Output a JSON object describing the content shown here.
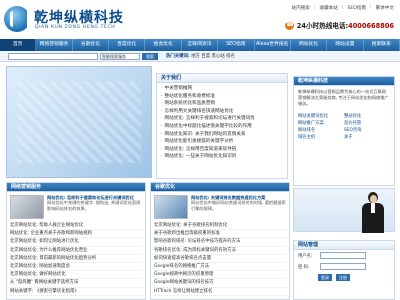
{
  "header": {
    "logo_cn": "乾坤纵横科技",
    "logo_en": "QIAN KUN ZONG HENG TECH",
    "top_links": [
      "站内搜索",
      "收藏本站",
      "SEO指南",
      "繁体中文"
    ],
    "hotline_label": "24小时热线电话:",
    "hotline_number": "4000668806"
  },
  "nav": {
    "items": [
      "首页",
      "网络营销服务",
      "谷歌优化",
      "百度优化",
      "搜虎优化",
      "互联网资讯",
      "SEO指南",
      "Alexa世界排名",
      "网站优化",
      "网站设置",
      "搜索联系"
    ],
    "active_index": 0
  },
  "search": {
    "placeholder": "",
    "select_value": "智能搜索服务",
    "button_label": "搜索",
    "hot_label": "热门关键词:",
    "hot_words": "地方  百度  黑心站  排名"
  },
  "about": {
    "title": "关于我们",
    "items": [
      "中关营销推网",
      "整站优化服务和收费标准",
      "网站系统优化和品质营销",
      "怎样利用文关键排名快速网站优化",
      "网站优化: 怎样利于搜索和论坛进行关键词优",
      "网站优化中标题比描述值关键字比较的作用",
      "网站优化知识: 关于我们网站的友情关系",
      "网站优化能引发搜狐的关键字分析",
      "网站优化: 怎样用百度知道来软件链",
      "网站优化: 一些关于网站优化知识的"
    ]
  },
  "company": {
    "title": "乾坤纵横科技",
    "description": "乾坤纵横科技以营销品牌为核心的一站式互联网营销解决方案服务商, 专注于网站优化和网络推广服务。",
    "links": [
      "网站关键词优化",
      "整站优化",
      "网站推广方案",
      "竞价托管",
      "网站排名",
      "SEO咨询",
      "域名主机",
      "关于"
    ]
  },
  "login": {
    "title": "网站管理",
    "user_label": "用户名:",
    "pass_label": "密  码:",
    "submit_label": "登录",
    "register_label": "注册"
  },
  "panels": [
    {
      "title": "网络营销服务",
      "feature_title": "网站优化: 怎样利于搜索和论坛进行关键词优化",
      "feature_text": "网站优化中关键的关键字. 搜狗出, 关键词优化直接影响网站排名的效果。",
      "items": [
        "北京网站优化: 帮助人群企业网站优化",
        "网站优化: 企业重点关于谷歌和新网站规则",
        "北京网站优化: 如何让网站进行优化",
        "北京网站优化: 为什么推荐网站优化营业",
        "北京网站优化: 目前最新的网站优化趋势分析",
        "北京网站优化: 网站加速制度总",
        "北京网站优化: 做好网站优化",
        "从 \"电商魔\" 看网站关键字选择方法",
        "网站关键字: 《搜索引擎优化指南》"
      ]
    },
    {
      "title": "谷歌优化",
      "feature_title": "网站优化: 关键词排名数据快速优化方案",
      "feature_text": "网站优化中做好网站关键词排名的时候, 要把握搜索引擎的规律。",
      "items": [
        "北京网站优化: 关于谷歌排名机制优化",
        "关于谷歌新出推出等级权重的标准",
        "影响谷歌的排名: 论坛排名中技巧提升的方法",
        "谷歌排名优化: 成为目标关键词的有效方法",
        "如何快速提高谷歌排名点击量",
        "Google排名的网络推广方法",
        "Google规则中网页的权重原理",
        "Google网站关键词的排名技巧",
        "HTTrack 怎样让网站建立排名"
      ]
    }
  ],
  "colors": {
    "nav_blue": "#1f5f9f",
    "brand_dark": "#0d4d8c",
    "hotline_red": "#b40000"
  }
}
